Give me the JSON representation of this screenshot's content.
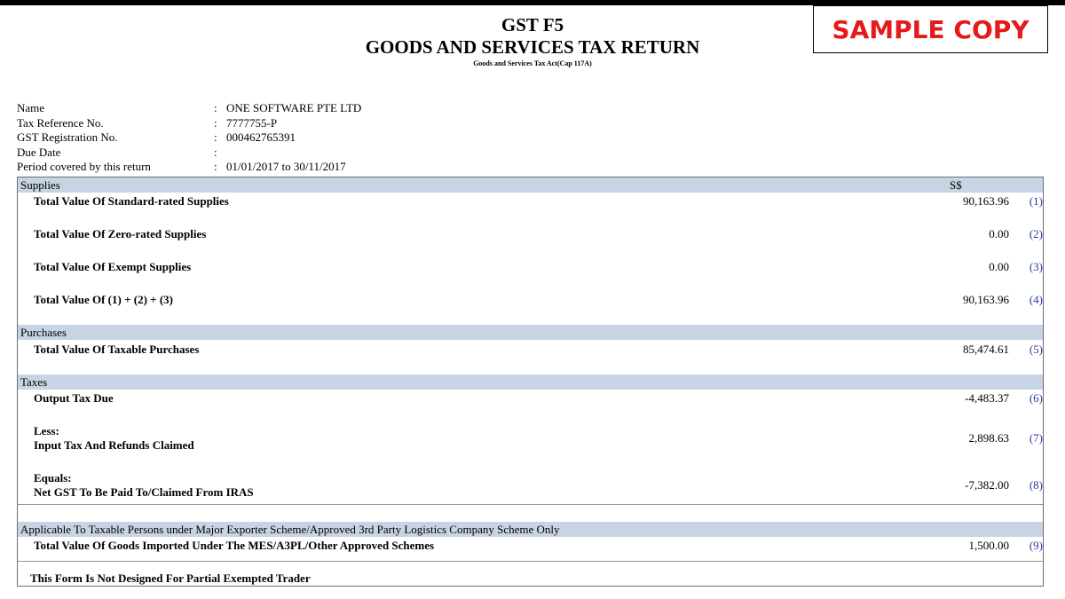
{
  "header": {
    "title": "GST F5",
    "subtitle": "GOODS AND SERVICES TAX RETURN",
    "act": "Goods and Services Tax Act(Cap 117A)",
    "stamp": "SAMPLE COPY"
  },
  "info": [
    {
      "label": "Name",
      "value": "ONE SOFTWARE PTE LTD"
    },
    {
      "label": "Tax Reference No.",
      "value": "7777755-P"
    },
    {
      "label": "GST Registration No.",
      "value": "000462765391"
    },
    {
      "label": "Due Date",
      "value": ""
    },
    {
      "label": "Period covered by this return",
      "value": "01/01/2017 to 30/11/2017"
    }
  ],
  "sections": {
    "supplies": "Supplies",
    "currency": "S$",
    "purchases": "Purchases",
    "taxes": "Taxes",
    "mes": "Applicable To Taxable Persons under Major Exporter Scheme/Approved 3rd Party Logistics Company Scheme Only"
  },
  "lines": [
    {
      "label": "Total Value Of Standard-rated Supplies",
      "value": "90,163.96",
      "ref": "(1)"
    },
    {
      "label": "Total Value Of Zero-rated Supplies",
      "value": "0.00",
      "ref": "(2)"
    },
    {
      "label": "Total Value Of Exempt Supplies",
      "value": "0.00",
      "ref": "(3)"
    },
    {
      "label": "Total Value Of (1) + (2) + (3)",
      "value": "90,163.96",
      "ref": "(4)"
    },
    {
      "label": "Total Value Of Taxable Purchases",
      "value": "85,474.61",
      "ref": "(5)"
    },
    {
      "label": "Output Tax Due",
      "value": "-4,483.37",
      "ref": "(6)"
    },
    {
      "label": "Input Tax And Refunds Claimed",
      "prefix": "Less:",
      "value": "2,898.63",
      "ref": "(7)"
    },
    {
      "label": "Net GST To Be Paid To/Claimed From IRAS",
      "prefix": "Equals:",
      "value": "-7,382.00",
      "ref": "(8)"
    },
    {
      "label": "Total Value Of Goods Imported Under The MES/A3PL/Other Approved Schemes",
      "value": "1,500.00",
      "ref": "(9)"
    }
  ],
  "footer_note": "This Form Is Not Designed For Partial Exempted Trader"
}
